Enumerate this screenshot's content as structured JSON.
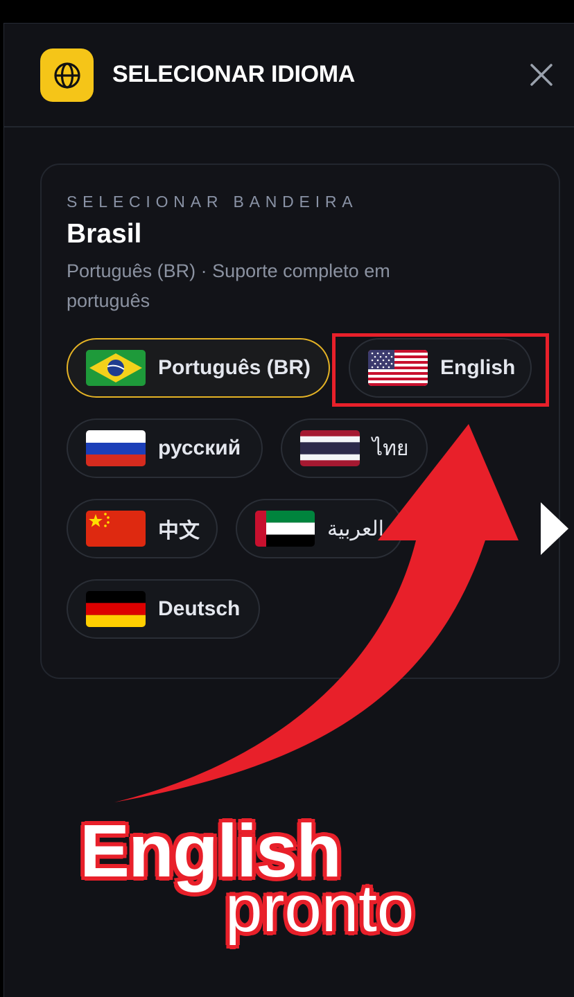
{
  "header": {
    "title": "SELECIONAR IDIOMA",
    "icon": "globe-icon",
    "close_icon": "close-icon"
  },
  "card": {
    "eyebrow": "SELECIONAR BANDEIRA",
    "country": "Brasil",
    "description": "Português (BR) · Suporte completo em português"
  },
  "languages": [
    {
      "label": "Português (BR)",
      "flag": "brazil-flag-icon",
      "selected": true
    },
    {
      "label": "English",
      "flag": "usa-flag-icon",
      "selected": false
    },
    {
      "label": "русский",
      "flag": "russia-flag-icon",
      "selected": false
    },
    {
      "label": "ไทย",
      "flag": "thailand-flag-icon",
      "selected": false
    },
    {
      "label": "中文",
      "flag": "china-flag-icon",
      "selected": false
    },
    {
      "label": "العربية",
      "flag": "uae-flag-icon",
      "selected": false
    },
    {
      "label": "Deutsch",
      "flag": "germany-flag-icon",
      "selected": false
    }
  ],
  "annotation": {
    "line1": "English",
    "line2": "pronto",
    "color": "#e8202a",
    "highlight_target": "English"
  },
  "colors": {
    "accent": "#f5c518",
    "background": "#111217",
    "highlight": "#e8202a"
  }
}
